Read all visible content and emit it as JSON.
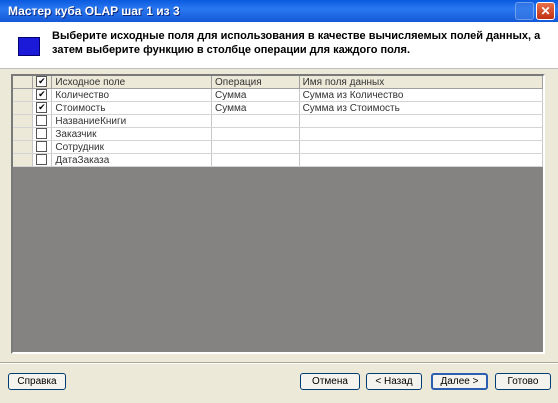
{
  "window": {
    "title": "Мастер куба OLAP шаг 1 из 3",
    "close_label": "✕"
  },
  "header": {
    "instruction": "Выберите исходные поля для использования в качестве вычисляемых полей данных, а затем выберите функцию в столбце операции для каждого поля."
  },
  "grid": {
    "columns": {
      "source_field": "Исходное поле",
      "operation": "Операция",
      "data_field_name": "Имя поля данных"
    },
    "header_checked": true,
    "rows": [
      {
        "checked": true,
        "source_field": "Количество",
        "operation": "Сумма",
        "data_field_name": "Сумма из Количество"
      },
      {
        "checked": true,
        "source_field": "Стоимость",
        "operation": "Сумма",
        "data_field_name": "Сумма из Стоимость"
      },
      {
        "checked": false,
        "source_field": "НазваниеКниги",
        "operation": "",
        "data_field_name": ""
      },
      {
        "checked": false,
        "source_field": "Заказчик",
        "operation": "",
        "data_field_name": ""
      },
      {
        "checked": false,
        "source_field": "Сотрудник",
        "operation": "",
        "data_field_name": ""
      },
      {
        "checked": false,
        "source_field": "ДатаЗаказа",
        "operation": "",
        "data_field_name": ""
      }
    ]
  },
  "buttons": {
    "help": "Справка",
    "cancel": "Отмена",
    "back": "< Назад",
    "next": "Далее >",
    "finish": "Готово"
  },
  "colors": {
    "title_bar": "#0a5ae0",
    "grid_background": "#858282",
    "wizard_icon": "#1a1ad8"
  }
}
